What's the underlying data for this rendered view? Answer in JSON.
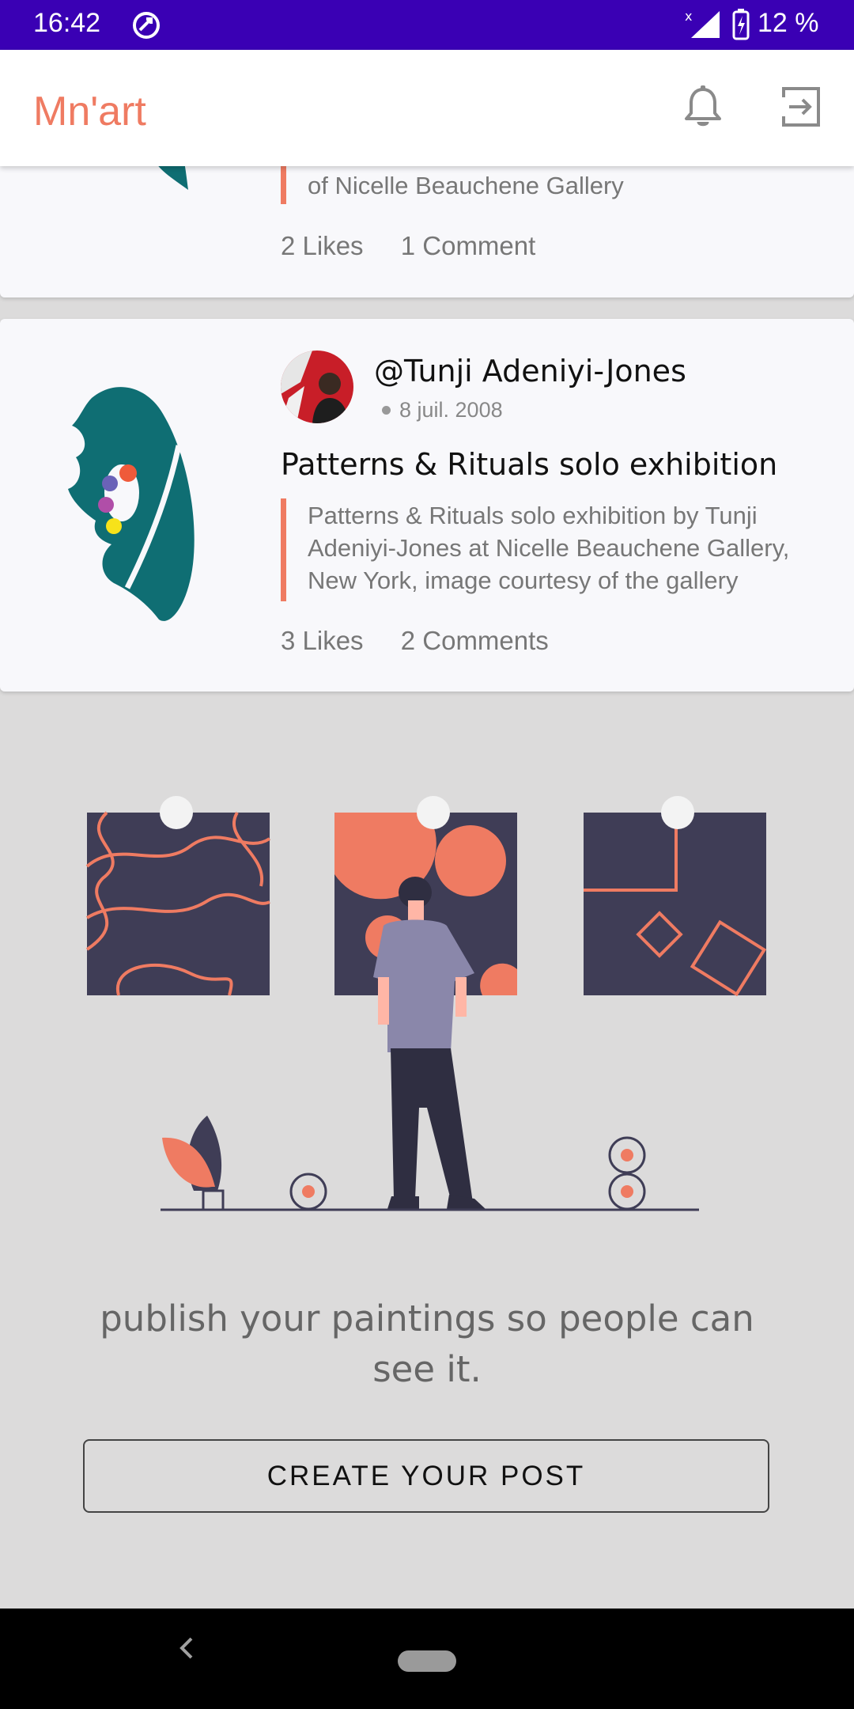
{
  "status_bar": {
    "time": "16:42",
    "battery": "12 %"
  },
  "app_bar": {
    "title": "Mn'art",
    "title_color": "#ef7b62"
  },
  "posts": [
    {
      "description_tail": "of Nicelle Beauchene Gallery",
      "likes": "2 Likes",
      "comments": "1 Comment"
    },
    {
      "author": "@Tunji Adeniyi-Jones",
      "date": "8 juil. 2008",
      "title": "Patterns & Rituals solo exhibition",
      "description_lines": [
        "Patterns & Rituals solo exhibition by Tunji",
        "Adeniyi-Jones at Nicelle Beauchene Gallery,",
        "New York, image courtesy of the gallery"
      ],
      "likes": "3 Likes",
      "comments": "2 Comments"
    }
  ],
  "empty_state": {
    "tagline": "publish your paintings so people can see it.",
    "button_label": "CREATE YOUR POST"
  },
  "icons": [
    "sync-icon",
    "signal-icon",
    "battery-charging-icon",
    "bell-icon",
    "logout-icon",
    "back-icon",
    "home-pill-icon"
  ],
  "colors": {
    "status_bar": "#3a00b4",
    "accent": "#ef7b62",
    "logo_teal": "#0f6e73",
    "art_dark": "#3f3d56"
  }
}
